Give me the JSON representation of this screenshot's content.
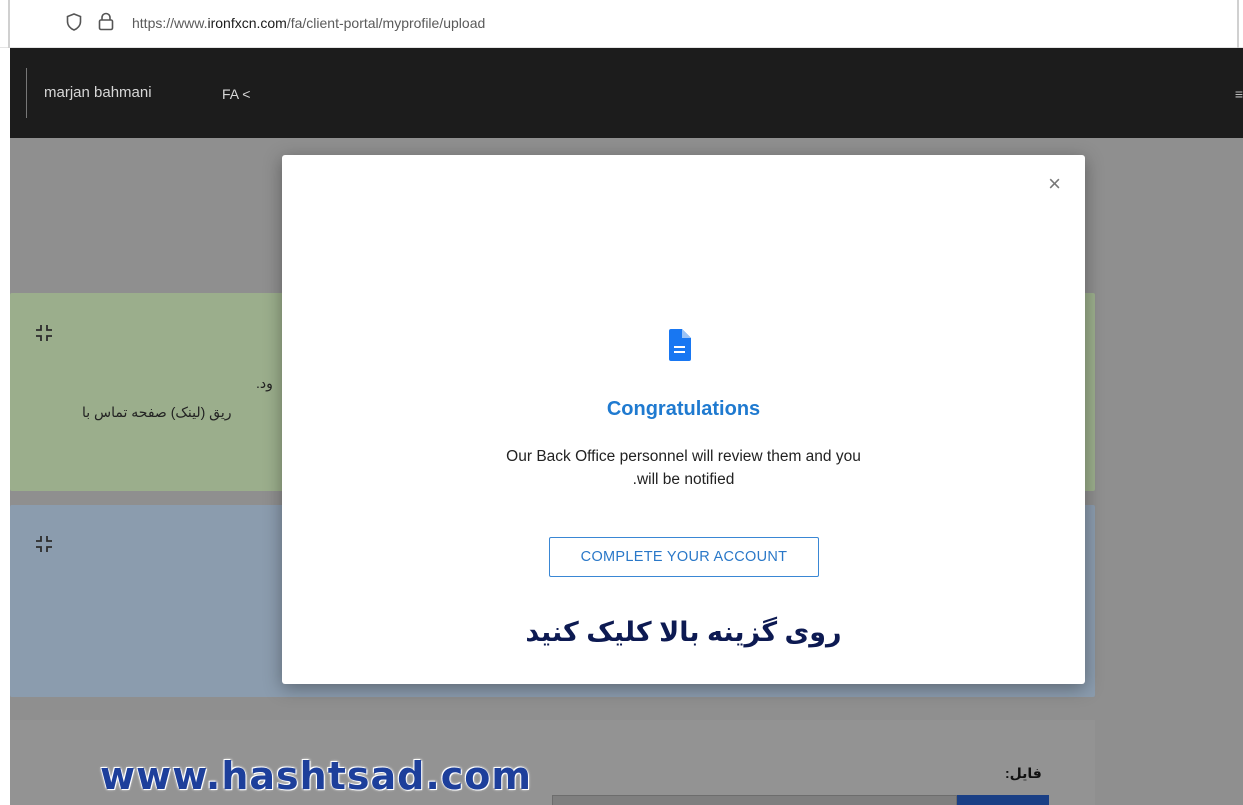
{
  "browser": {
    "url_prefix": "https://www.",
    "url_domain": "ironfxcn.com",
    "url_path": "/fa/client-portal/myprofile/upload",
    "icons": [
      "shield-icon",
      "lock-icon"
    ]
  },
  "header": {
    "user_name": "marjan bahmani",
    "language": "FA <",
    "menu_icon": "≡"
  },
  "background": {
    "green_panel_line1": "ود.",
    "green_panel_line2": "ریق (لینک) صفحه تماس با",
    "file_label": "فایل:"
  },
  "modal": {
    "close_label": "×",
    "icon": "document-icon",
    "title": "Congratulations",
    "message_line1": "Our Back Office personnel will review them and you",
    "message_line2": ".will be notified",
    "button_label": "COMPLETE YOUR ACCOUNT",
    "instruction": "روی گزینه بالا کلیک کنید"
  },
  "watermark": "www.hashtsad.com",
  "colors": {
    "accent": "#1f7ad0",
    "header_bg": "#1c1c1c",
    "instruction_text": "#0d1a52",
    "watermark": "#1d3f9b"
  }
}
